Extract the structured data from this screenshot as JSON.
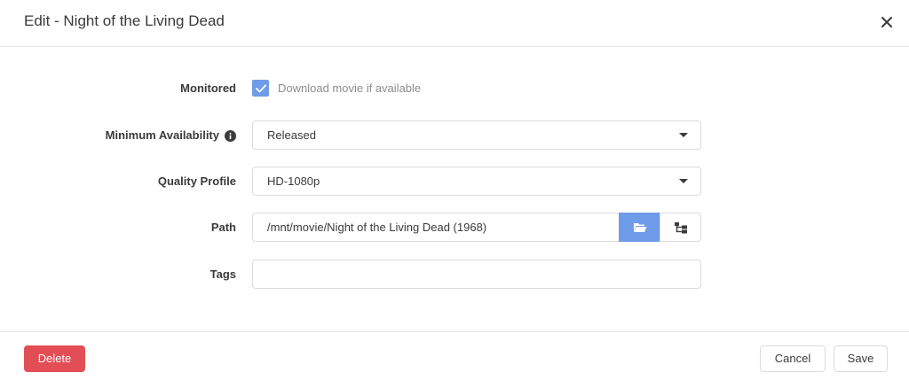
{
  "modal": {
    "title": "Edit - Night of the Living Dead"
  },
  "form": {
    "monitored": {
      "label": "Monitored",
      "checkbox_label": "Download movie if available",
      "checked": true
    },
    "minimum_availability": {
      "label": "Minimum Availability",
      "value": "Released"
    },
    "quality_profile": {
      "label": "Quality Profile",
      "value": "HD-1080p"
    },
    "path": {
      "label": "Path",
      "value": "/mnt/movie/Night of the Living Dead (1968)"
    },
    "tags": {
      "label": "Tags",
      "value": ""
    }
  },
  "footer": {
    "delete_label": "Delete",
    "cancel_label": "Cancel",
    "save_label": "Save"
  },
  "colors": {
    "primary": "#6f9ce8",
    "danger": "#e34d55"
  },
  "icons": {
    "close": "close-icon",
    "info": "info-icon",
    "check": "checkmark-icon",
    "folder": "folder-open-icon",
    "tree": "file-tree-icon",
    "caret": "caret-down-icon"
  }
}
